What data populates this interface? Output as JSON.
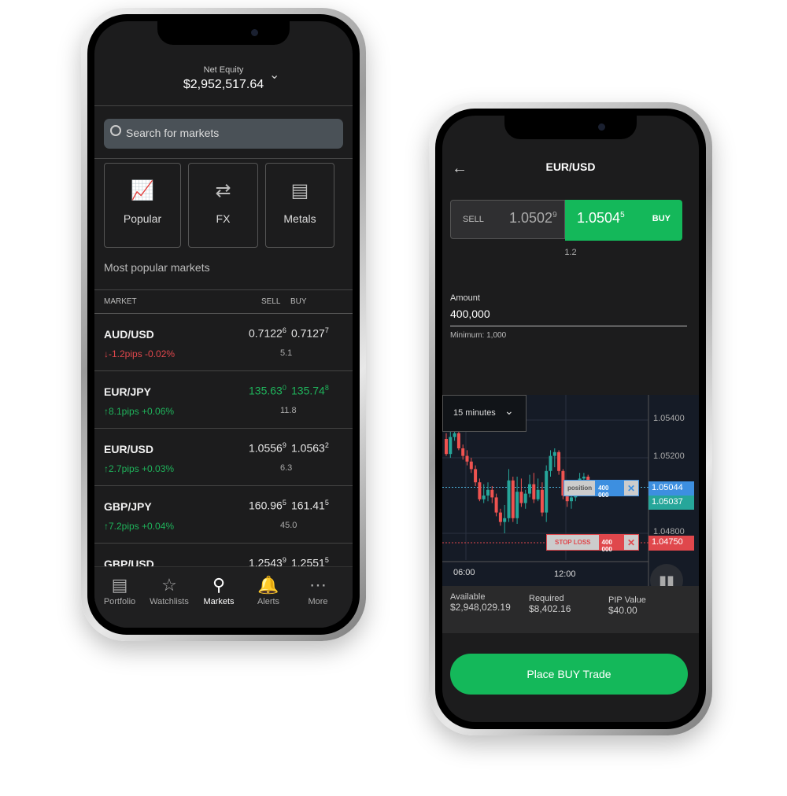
{
  "left": {
    "equity_label": "Net Equity",
    "equity_value": "$2,952,517.64",
    "search_placeholder": "Search for markets",
    "tiles": [
      {
        "label": "Popular",
        "icon": "chart-line-icon"
      },
      {
        "label": "FX",
        "icon": "currency-exchange-icon"
      },
      {
        "label": "Metals",
        "icon": "gold-bars-icon"
      }
    ],
    "section_title": "Most popular markets",
    "columns": {
      "market": "MARKET",
      "sell": "SELL",
      "buy": "BUY"
    },
    "markets": [
      {
        "name": "AUD/USD",
        "sell": "0.7122",
        "sell_sup": "6",
        "buy": "0.7127",
        "buy_sup": "7",
        "change": "-1.2pips -0.02%",
        "dir": "down",
        "spread": "5.1",
        "price_color": "white"
      },
      {
        "name": "EUR/JPY",
        "sell": "135.63",
        "sell_sup": "0",
        "buy": "135.74",
        "buy_sup": "8",
        "change": "8.1pips +0.06%",
        "dir": "up",
        "spread": "11.8",
        "price_color": "green"
      },
      {
        "name": "EUR/USD",
        "sell": "1.0556",
        "sell_sup": "9",
        "buy": "1.0563",
        "buy_sup": "2",
        "change": "2.7pips +0.03%",
        "dir": "up",
        "spread": "6.3",
        "price_color": "white"
      },
      {
        "name": "GBP/JPY",
        "sell": "160.96",
        "sell_sup": "5",
        "buy": "161.41",
        "buy_sup": "5",
        "change": "7.2pips +0.04%",
        "dir": "up",
        "spread": "45.0",
        "price_color": "white"
      },
      {
        "name": "GBP/USD",
        "sell": "1.2543",
        "sell_sup": "9",
        "buy": "1.2551",
        "buy_sup": "5",
        "change": "",
        "dir": "",
        "spread": "",
        "price_color": "white"
      }
    ],
    "nav": [
      {
        "label": "Portfolio",
        "icon": "portfolio-icon"
      },
      {
        "label": "Watchlists",
        "icon": "watchlist-icon"
      },
      {
        "label": "Markets",
        "icon": "search-icon",
        "active": true
      },
      {
        "label": "Alerts",
        "icon": "bell-icon"
      },
      {
        "label": "More",
        "icon": "more-icon"
      }
    ]
  },
  "right": {
    "title": "EUR/USD",
    "sell_label": "SELL",
    "sell_price": "1.0502",
    "sell_sup": "9",
    "buy_label": "BUY",
    "buy_price": "1.0504",
    "buy_sup": "5",
    "spread": "1.2",
    "amount_label": "Amount",
    "amount_value": "400,000",
    "amount_min": "Minimum: 1,000",
    "timeframe": "15 minutes",
    "y_ticks": [
      "1.05400",
      "1.05200",
      "1.04800"
    ],
    "x_ticks": [
      "06:00",
      "12:00"
    ],
    "position_label": "position",
    "position_qty": "400 000",
    "position_price": "1.05044",
    "last_price": "1.05037",
    "stoploss_label": "STOP LOSS",
    "stoploss_qty": "400 000",
    "stoploss_price": "1.04750",
    "available_label": "Available",
    "available_value": "$2,948,029.19",
    "required_label": "Required",
    "required_value": "$8,402.16",
    "pip_label": "PIP Value",
    "pip_value": "$40.00",
    "cta": "Place BUY Trade",
    "colors": {
      "buy": "#14b85a",
      "up": "#26a69a",
      "down": "#ef5350",
      "position": "#3d8fe0",
      "stoploss": "#e0474c"
    }
  },
  "chart_data": {
    "type": "candlestick",
    "candles": [
      [
        1.053,
        1.0522,
        1.0533,
        1.0521
      ],
      [
        1.0522,
        1.0531,
        1.0534,
        1.052
      ],
      [
        1.0531,
        1.0533,
        1.0536,
        1.0529
      ],
      [
        1.0533,
        1.0525,
        1.0537,
        1.0524
      ],
      [
        1.0525,
        1.0521,
        1.0527,
        1.0519
      ],
      [
        1.0521,
        1.0518,
        1.0524,
        1.0516
      ],
      [
        1.0518,
        1.0514,
        1.052,
        1.0512
      ],
      [
        1.0514,
        1.0507,
        1.0516,
        1.0505
      ],
      [
        1.0507,
        1.0498,
        1.0509,
        1.0497
      ],
      [
        1.0498,
        1.05,
        1.0506,
        1.0496
      ],
      [
        1.05,
        1.0503,
        1.0507,
        1.0497
      ],
      [
        1.0503,
        1.0499,
        1.0505,
        1.0496
      ],
      [
        1.0499,
        1.0491,
        1.0501,
        1.0489
      ],
      [
        1.0491,
        1.0486,
        1.0493,
        1.0484
      ],
      [
        1.0486,
        1.0488,
        1.0495,
        1.048
      ],
      [
        1.0488,
        1.0508,
        1.0514,
        1.0486
      ],
      [
        1.0508,
        1.0488,
        1.051,
        1.0486
      ],
      [
        1.0488,
        1.0502,
        1.051,
        1.0485
      ],
      [
        1.0502,
        1.0496,
        1.0509,
        1.0494
      ],
      [
        1.0496,
        1.0501,
        1.0503,
        1.0493
      ],
      [
        1.0501,
        1.0506,
        1.0511,
        1.0499
      ],
      [
        1.0506,
        1.0498,
        1.0512,
        1.0496
      ],
      [
        1.0498,
        1.0503,
        1.0509,
        1.0497
      ],
      [
        1.0503,
        1.0491,
        1.0507,
        1.0489
      ],
      [
        1.0491,
        1.0513,
        1.0516,
        1.0486
      ],
      [
        1.0513,
        1.0521,
        1.0524,
        1.051
      ],
      [
        1.0521,
        1.0523,
        1.0525,
        1.0515
      ],
      [
        1.0523,
        1.0513,
        1.0524,
        1.0511
      ],
      [
        1.0513,
        1.05,
        1.0514,
        1.0498
      ],
      [
        1.05,
        1.0497,
        1.0505,
        1.0494
      ],
      [
        1.0497,
        1.0499,
        1.0503,
        1.0493
      ],
      [
        1.0499,
        1.0504,
        1.0508,
        1.0497
      ],
      [
        1.0504,
        1.0509,
        1.0512,
        1.0502
      ],
      [
        1.0509,
        1.051,
        1.0512,
        1.0506
      ],
      [
        1.051,
        1.0503,
        1.0511,
        1.05
      ]
    ],
    "ylim": [
      1.047,
      1.056
    ]
  }
}
